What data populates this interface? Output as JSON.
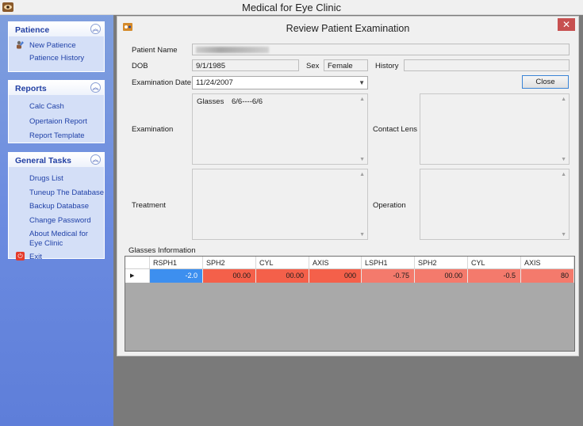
{
  "window": {
    "title": "Medical for Eye Clinic"
  },
  "sidebar": {
    "groups": [
      {
        "title": "Patience",
        "items": [
          {
            "label": "New Patience"
          },
          {
            "label": "Patience History"
          }
        ]
      },
      {
        "title": "Reports",
        "items": [
          {
            "label": "Calc Cash"
          },
          {
            "label": "Opertaion Report"
          },
          {
            "label": "Report Template"
          }
        ]
      },
      {
        "title": "General Tasks",
        "items": [
          {
            "label": "Drugs List"
          },
          {
            "label": "Tuneup The Database"
          },
          {
            "label": "Backup Database"
          },
          {
            "label": "Change Password"
          },
          {
            "label": "About Medical for Eye Clinic"
          },
          {
            "label": "Exit"
          }
        ]
      }
    ]
  },
  "dialog": {
    "title": "Review Patient Examination",
    "close_glyph": "✕",
    "labels": {
      "patient_name": "Patient Name",
      "dob": "DOB",
      "sex": "Sex",
      "history": "History",
      "exam_date": "Examination Date",
      "examination": "Examination",
      "contact_lens": "Contact Lens",
      "treatment": "Treatment",
      "operation": "Operation",
      "glasses_info": "Glasses Information"
    },
    "values": {
      "dob": "9/1/1985",
      "sex": "Female",
      "history": "",
      "exam_date": "11/24/2007"
    },
    "close_button": "Close",
    "examination_text": {
      "label": "Glasses",
      "value": "6/6----6/6"
    }
  },
  "grid": {
    "columns": [
      "RSPH1",
      "SPH2",
      "CYL",
      "AXIS",
      "LSPH1",
      "SPH2",
      "CYL",
      "AXIS"
    ],
    "row": [
      "-2.0",
      "00.00",
      "00.00",
      "000",
      "-0.75",
      "00.00",
      "-0.5",
      "80"
    ],
    "row_indicator": "▶",
    "cell_colors": [
      "#3d8fef",
      "#f4604a",
      "#f4604a",
      "#f4604a",
      "#f47a6c",
      "#f47a6c",
      "#f47a6c",
      "#f47a6c"
    ]
  }
}
